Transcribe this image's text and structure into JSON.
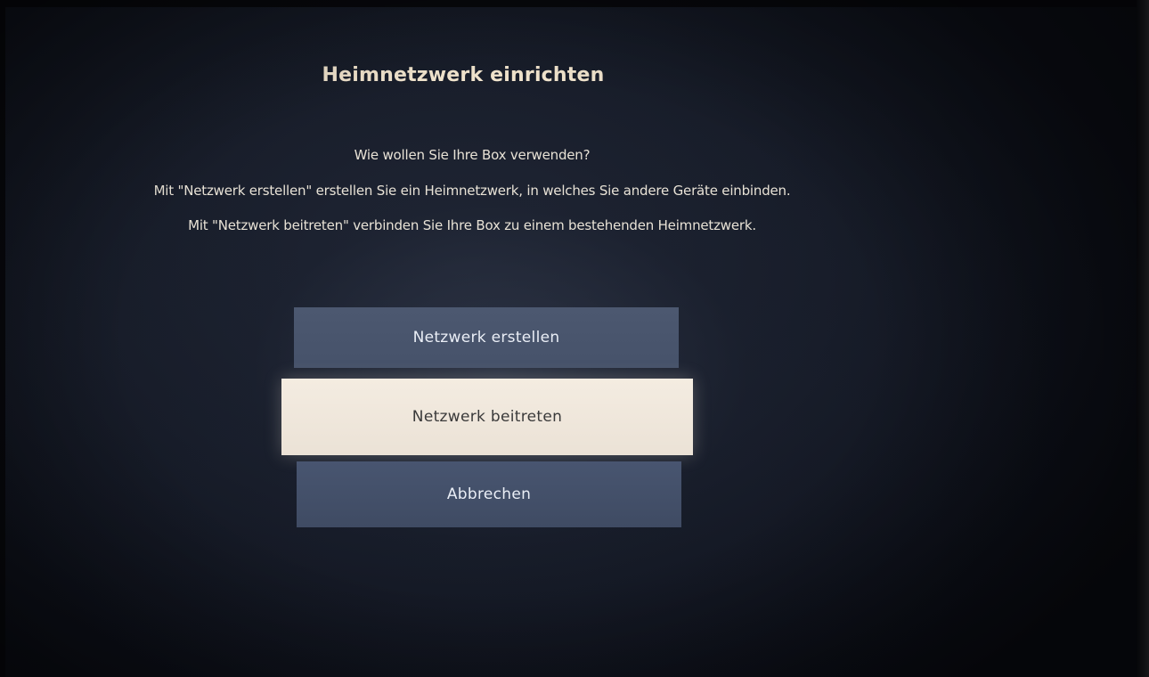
{
  "dialog": {
    "title": "Heimnetzwerk einrichten",
    "question": "Wie wollen Sie Ihre Box verwenden?",
    "description_line1": "Mit \"Netzwerk erstellen\" erstellen Sie ein Heimnetzwerk, in welches Sie andere Geräte einbinden.",
    "description_line2": "Mit \"Netzwerk beitreten\" verbinden Sie Ihre Box zu einem bestehenden Heimnetzwerk."
  },
  "buttons": {
    "create_label": "Netzwerk erstellen",
    "join_label": "Netzwerk beitreten",
    "cancel_label": "Abbrechen",
    "focused": "join"
  },
  "colors": {
    "background": "#161b27",
    "button": "#4a566e",
    "button_focused": "#f2eadf",
    "title_text": "#f3e6cf"
  }
}
